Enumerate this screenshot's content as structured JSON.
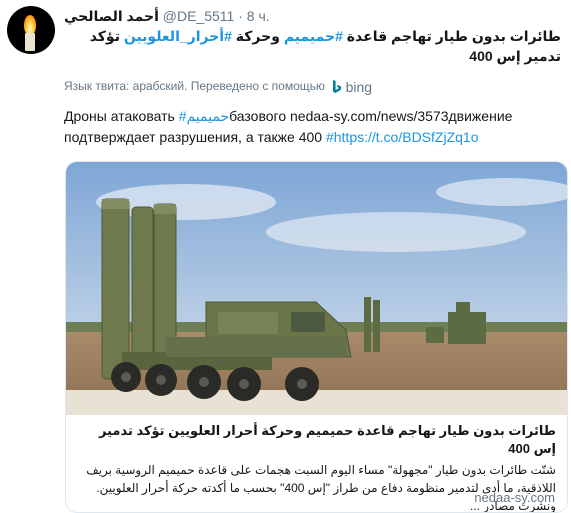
{
  "header": {
    "display_name": "أحمد الصالحي",
    "handle": "@DE_5511",
    "separator": "·",
    "time": "8 ч."
  },
  "tweet": {
    "original_text_main": "طائرات بدون طيار تهاجم قاعدة ",
    "original_hashtag_1": "#حميميم",
    "original_text_mid": " وحركة ",
    "original_hashtag_2": "#أحرار_العلويين",
    "original_text_end": " تؤكد تدمير إس 400",
    "translation_notice": "Язык твита: арабский. Переведено с помощью",
    "translation_provider": "bing",
    "translated_before": "Дроны атаковать ",
    "translated_hashtag": "#حميميم",
    "translated_middle": "базового nedaa-sy.com/news/3573движение подтверждает разрушения, а также 400 ",
    "translated_link": "#https://t.co/BDSfZjZq1o"
  },
  "card": {
    "title": "طائرات بدون طيار تهاجم قاعدة حميميم وحركة أحرار العلويين تؤكد تدمير إس 400",
    "description": "شنّت طائرات بدون طيار \"مجهولة\" مساء اليوم السبت هجمات على قاعدة حميميم الروسية بريف اللاذقية، ما أدى لتدمير منظومة دفاع من طراز \"إس 400\" بحسب ما أكدته حركة أحرار العلويين. ونشرت مصادر ...",
    "domain": "nedaa-sy.com"
  },
  "colors": {
    "link": "#1b95e0",
    "muted": "#657786",
    "text": "#14171a"
  },
  "icons": [
    "avatar-candle-icon",
    "bing-logo-icon"
  ]
}
